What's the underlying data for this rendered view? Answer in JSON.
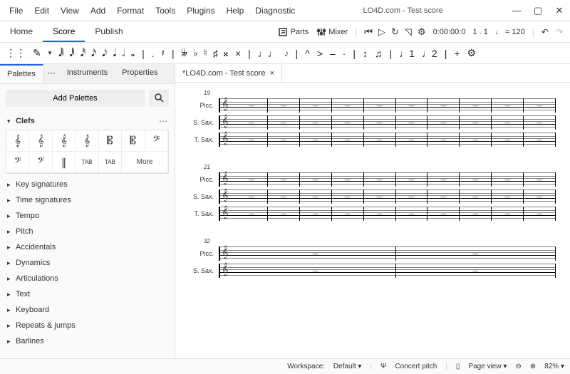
{
  "window": {
    "title": "LO4D.com - Test score"
  },
  "menus": [
    "File",
    "Edit",
    "View",
    "Add",
    "Format",
    "Tools",
    "Plugins",
    "Help",
    "Diagnostic"
  ],
  "main_tabs": {
    "items": [
      "Home",
      "Score",
      "Publish"
    ],
    "active": 1
  },
  "top_toolbar": {
    "parts": "Parts",
    "mixer": "Mixer",
    "time": "0:00:00:0",
    "position": "1 . 1",
    "tempo_glyph": "♩",
    "tempo_eq": "= 120"
  },
  "note_toolbar": {
    "grip": "⋮⋮",
    "pencil": "✎",
    "durations": [
      "𝅘𝅥𝅲",
      "𝅘𝅥𝅱",
      "𝅘𝅥𝅰",
      "𝅘𝅥𝅯",
      "𝅘𝅥𝅮",
      "𝅘𝅥",
      "𝅗𝅥",
      "𝅝"
    ],
    "dot": ".",
    "rest": "𝄽",
    "accidentals": [
      "𝄫",
      "♭",
      "♮",
      "♯",
      "𝄪"
    ],
    "cross": "×",
    "tie": "♩♩",
    "slur": "𝆔",
    "marcato": "^",
    "accent": ">",
    "tenuto": "–",
    "staccato": "·",
    "flip": "↕",
    "beam": "♫",
    "voice1": "♩1",
    "voice2": "♩2",
    "plus": "+",
    "gear": "⚙"
  },
  "panel_tabs": {
    "items": [
      "Palettes",
      "Instruments",
      "Properties"
    ],
    "active": 0
  },
  "sidebar": {
    "add_label": "Add Palettes",
    "clefs_label": "Clefs",
    "clefs_glyphs": [
      "𝄞",
      "𝄞",
      "𝄞",
      "𝄞",
      "𝄡",
      "𝄡",
      "𝄢",
      "𝄢",
      "𝄢",
      "∥",
      "TAB",
      "TAB"
    ],
    "more": "More",
    "sections": [
      "Key signatures",
      "Time signatures",
      "Tempo",
      "Pitch",
      "Accidentals",
      "Dynamics",
      "Articulations",
      "Text",
      "Keyboard",
      "Repeats & jumps",
      "Barlines"
    ]
  },
  "doc_tab": {
    "label": "*LO4D.com - Test score",
    "close": "×"
  },
  "score": {
    "systems": [
      {
        "bar": "19",
        "instruments": [
          "Picc.",
          "S. Sax.",
          "T. Sax."
        ],
        "measures": 10
      },
      {
        "bar": "21",
        "instruments": [
          "Picc.",
          "S. Sax.",
          "T. Sax."
        ],
        "measures": 10
      },
      {
        "bar": "32",
        "instruments": [
          "Picc.",
          "S. Sax."
        ],
        "measures": 2
      }
    ],
    "clef_glyph": "𝄞",
    "rest_glyph": "—"
  },
  "status": {
    "workspace_label": "Workspace:",
    "workspace_value": "Default",
    "concert": "Concert pitch",
    "view": "Page view",
    "zoom": "82%"
  }
}
